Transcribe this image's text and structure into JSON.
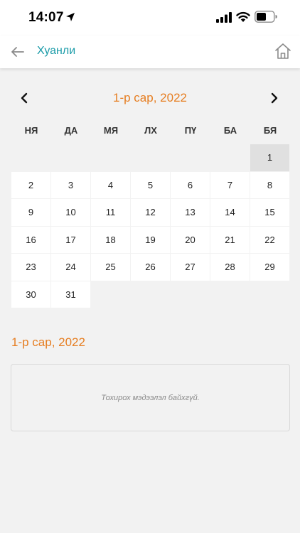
{
  "status_bar": {
    "time": "14:07"
  },
  "header": {
    "title": "Хуанли",
    "back_icon": "arrow-left-icon",
    "home_icon": "home-icon"
  },
  "calendar": {
    "month_title": "1-р сар, 2022",
    "weekdays": [
      "НЯ",
      "ДА",
      "МЯ",
      "ЛХ",
      "ПҮ",
      "БА",
      "БЯ"
    ],
    "first_weekday_index": 6,
    "days_in_month": 31,
    "selected_day": 1,
    "days": [
      "1",
      "2",
      "3",
      "4",
      "5",
      "6",
      "7",
      "8",
      "9",
      "10",
      "11",
      "12",
      "13",
      "14",
      "15",
      "16",
      "17",
      "18",
      "19",
      "20",
      "21",
      "22",
      "23",
      "24",
      "25",
      "26",
      "27",
      "28",
      "29",
      "30",
      "31"
    ]
  },
  "events": {
    "title": "1-р сар, 2022",
    "empty_message": "Тохирох мэдээлэл байхгүй."
  },
  "colors": {
    "accent_teal": "#1a9ba8",
    "accent_orange": "#e67e22",
    "selected_day_bg": "#e0e0e0",
    "background": "#f2f2f2"
  }
}
